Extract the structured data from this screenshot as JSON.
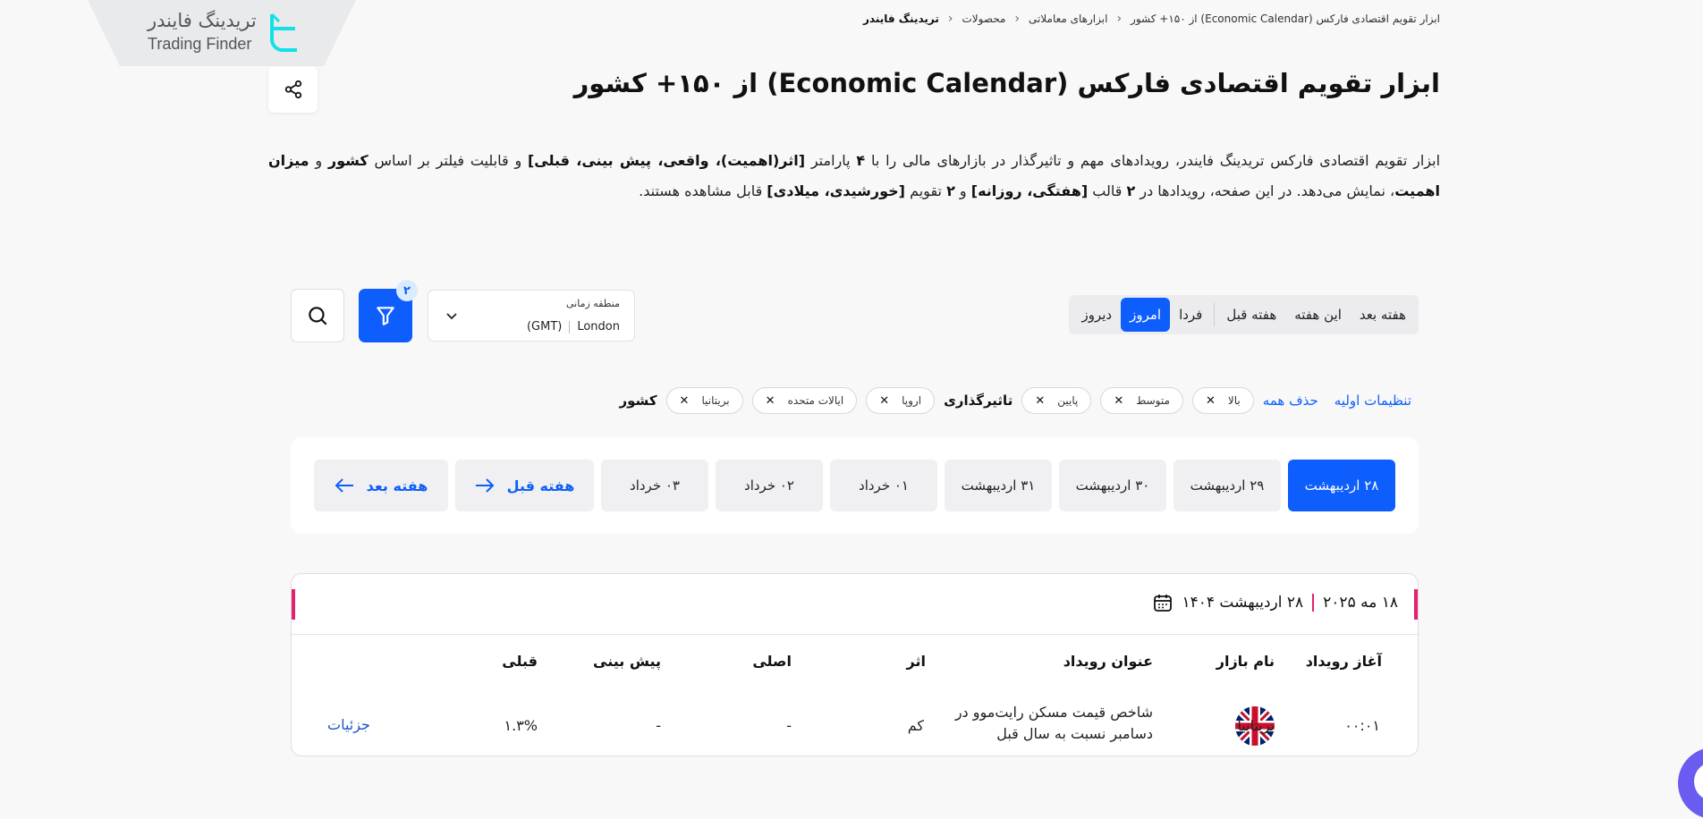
{
  "logo": {
    "name_fa": "تریدینگ فایندر",
    "name_en": "Trading Finder"
  },
  "breadcrumb": {
    "items": [
      "تریدینگ فایندر",
      "محصولات",
      "ابزارهای معاملاتی",
      "ابزار تقویم اقتصادی فارکس (Economic Calendar) از ۱۵۰+ کشور"
    ]
  },
  "page": {
    "title": "ابزار تقویم اقتصادی فارکس (Economic Calendar) از ۱۵۰+ کشور",
    "desc": {
      "t1": "ابزار تقویم اقتصادی فارکس تریدینگ فایندر، رویدادهای مهم و تاثیرگذار در بازارهای مالی را با ",
      "b1": "۴",
      "t2": " پارامتر ",
      "b2": "[اثر(اهمیت)، واقعی، پیش بینی، قبلی]",
      "t3": " و قابلیت فیلتر بر اساس ",
      "b3": "کشور",
      "t4": " و ",
      "b4": "میزان اهمیت",
      "t5": "، نمایش می‌دهد. در این صفحه، رویدادها در ",
      "b5": "۲",
      "t6": " قالب ",
      "b6": "[هفتگی، روزانه]",
      "t7": " و ",
      "b7": "۲",
      "t8": " تقویم ",
      "b8": "[خورشیدی، میلادی]",
      "t9": " قابل مشاهده هستند."
    }
  },
  "day_tabs": [
    "دیروز",
    "امروز",
    "فردا",
    "هفته قبل",
    "این هفته",
    "هفته بعد"
  ],
  "timezone": {
    "label": "منطقه زمانی",
    "city": "London",
    "code": "(GMT)"
  },
  "filter": {
    "badge": "۲"
  },
  "filters": {
    "country_label": "کشور",
    "countries": [
      "بریتانیا",
      "ایالات متحده",
      "اروپا"
    ],
    "impact_label": "تاثیرگذاری",
    "impacts": [
      "پایین",
      "متوسط",
      "بالا"
    ],
    "clear_all": "حذف همه",
    "reset": "تنظیمات اولیه"
  },
  "week": {
    "days": [
      "۲۸ اردیبهشت",
      "۲۹ اردیبهشت",
      "۳۰ اردیبهشت",
      "۳۱ اردیبهشت",
      "۰۱ خرداد",
      "۰۲ خرداد",
      "۰۳ خرداد"
    ],
    "prev": "هفته قبل",
    "next": "هفته بعد"
  },
  "events": {
    "date_shamsi": "۲۸ اردیبهشت ۱۴۰۴",
    "date_gregorian": "۱۸ مه ۲۰۲۵",
    "columns": {
      "start": "آغاز رویداد",
      "market": "نام بازار",
      "title": "عنوان رویداد",
      "impact": "اثر",
      "actual": "اصلی",
      "forecast": "پیش بینی",
      "previous": "قبلی"
    },
    "rows": [
      {
        "time": "۰۰:۰۱",
        "market": "بریتانیا",
        "title": "شاخص قیمت مسکن رایت‌موو در دسامبر نسبت به سال قبل",
        "impact": "کم",
        "actual": "-",
        "forecast": "-",
        "previous": "۱.۳%",
        "details": "جزئیات"
      }
    ]
  },
  "colors": {
    "accent": "#0d5efc",
    "highlight": "#e5206f",
    "logo_mark": "#14e0e8"
  }
}
